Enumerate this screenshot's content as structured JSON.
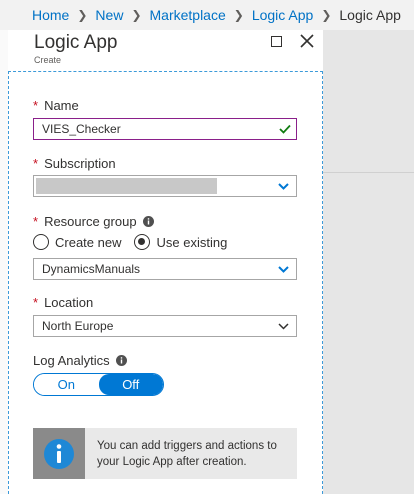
{
  "breadcrumb": {
    "items": [
      "Home",
      "New",
      "Marketplace",
      "Logic App"
    ],
    "current": "Logic App"
  },
  "blade": {
    "title": "Logic App",
    "subtitle": "Create"
  },
  "form": {
    "required_marker": "*",
    "name": {
      "label": "Name",
      "value": "VIES_Checker"
    },
    "subscription": {
      "label": "Subscription",
      "value": ""
    },
    "resource_group": {
      "label": "Resource group",
      "options": [
        "Create new",
        "Use existing"
      ],
      "selected": "Use existing",
      "value": "DynamicsManuals"
    },
    "location": {
      "label": "Location",
      "value": "North Europe"
    },
    "log_analytics": {
      "label": "Log Analytics",
      "on_label": "On",
      "off_label": "Off",
      "state": "Off"
    }
  },
  "info_box": {
    "text": "You can add triggers and actions to your Logic App after creation."
  },
  "colors": {
    "accent": "#0078d4",
    "link": "#0072c6",
    "required": "#c50f1f",
    "valid": "#107c10"
  }
}
